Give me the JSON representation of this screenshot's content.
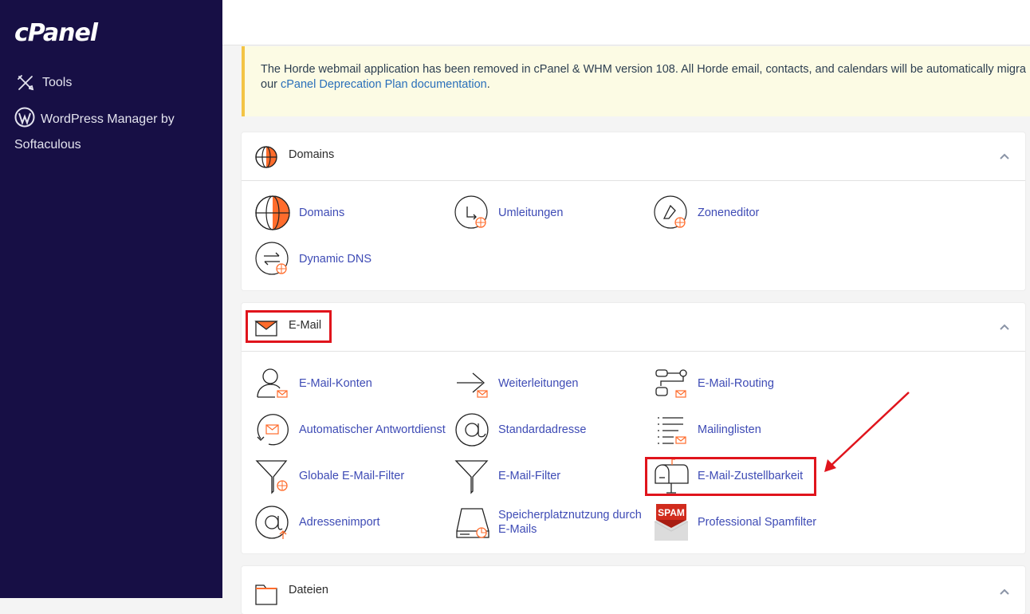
{
  "sidebar": {
    "logo": "cPanel",
    "items": [
      {
        "label": "Tools",
        "icon": "tools-icon"
      },
      {
        "label": "WordPress Manager by Softaculous",
        "icon": "wordpress-icon"
      }
    ]
  },
  "notice": {
    "text": "The Horde webmail application has been removed in cPanel & WHM version 108. All Horde email, contacts, and calendars will be automatically migra",
    "text2_prefix": "our ",
    "link": "cPanel Deprecation Plan documentation",
    "text2_suffix": "."
  },
  "sections": {
    "domains": {
      "title": "Domains",
      "items": [
        "Domains",
        "Umleitungen",
        "Zoneneditor",
        "Dynamic DNS"
      ]
    },
    "email": {
      "title": "E-Mail",
      "items": [
        "E-Mail-Konten",
        "Weiterleitungen",
        "E-Mail-Routing",
        "Automatischer Antwortdienst",
        "Standardadresse",
        "Mailinglisten",
        "Globale E-Mail-Filter",
        "E-Mail-Filter",
        "E-Mail-Zustellbarkeit",
        "Adressenimport",
        "Speicherplatznutzung durch E-Mails",
        "Professional Spamfilter"
      ]
    },
    "files": {
      "title": "Dateien"
    }
  },
  "spam_badge": "SPAM",
  "colors": {
    "sidebar": "#170f45",
    "link": "#3e4bb5",
    "accent": "#ff6c2c",
    "highlight": "#e0141c"
  }
}
